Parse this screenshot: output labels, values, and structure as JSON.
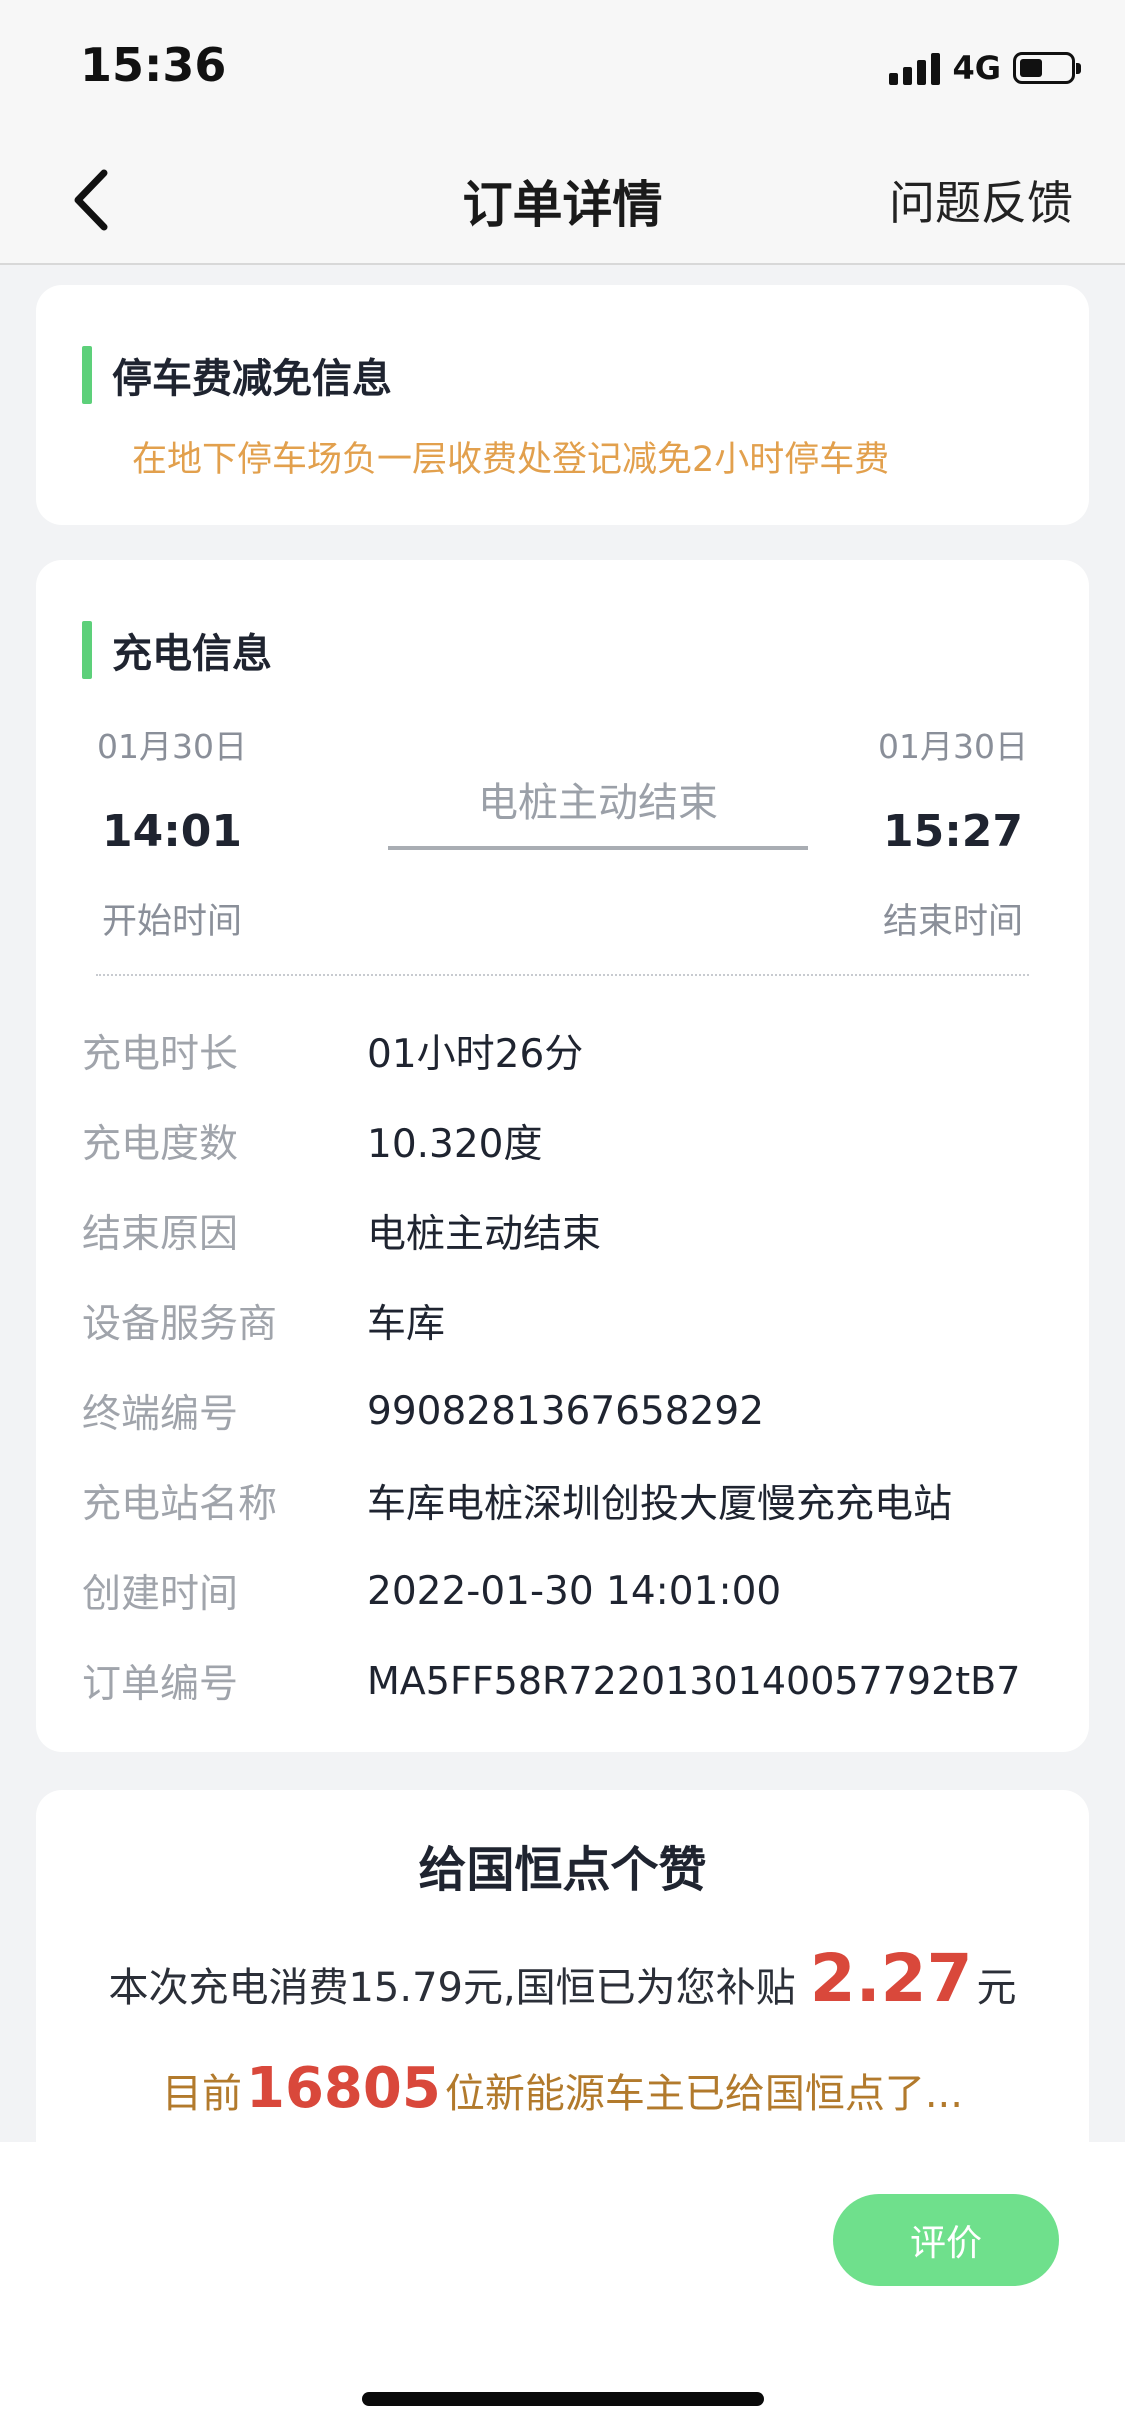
{
  "status_bar": {
    "time": "15:36",
    "network": "4G",
    "battery_level": 0.45
  },
  "nav": {
    "title": "订单详情",
    "feedback": "问题反馈",
    "back_icon": "chevron-left-icon"
  },
  "parking": {
    "title": "停车费减免信息",
    "note": "在地下停车场负一层收费处登记减免2小时停车费"
  },
  "charging": {
    "title": "充电信息",
    "start": {
      "date": "01月30日",
      "time": "14:01",
      "label": "开始时间"
    },
    "end": {
      "date": "01月30日",
      "time": "15:27",
      "label": "结束时间"
    },
    "end_reason": "电桩主动结束",
    "details": [
      {
        "label": "充电时长",
        "value": "01小时26分"
      },
      {
        "label": "充电度数",
        "value": "10.320度"
      },
      {
        "label": "结束原因",
        "value": "电桩主动结束"
      },
      {
        "label": "设备服务商",
        "value": "车库"
      },
      {
        "label": "终端编号",
        "value": "9908281367658292"
      },
      {
        "label": "充电站名称",
        "value": "车库电桩深圳创投大厦慢充充电站"
      },
      {
        "label": "创建时间",
        "value": "2022-01-30 14:01:00"
      },
      {
        "label": "订单编号",
        "value": "MA5FF58R7220130140057792tB7"
      }
    ]
  },
  "like": {
    "title": "给国恒点个赞",
    "line1_prefix": "本次充电消费15.79元,国恒已为您补贴",
    "subsidy": "2.27",
    "line1_suffix": "元",
    "line2_prefix": "目前",
    "count": "16805",
    "line2_suffix": "位新能源车主已给国恒点了..."
  },
  "bottom": {
    "rate_label": "评价"
  },
  "colors": {
    "accent_green": "#5dd07a",
    "button_green": "#6fe08c",
    "highlight_red": "#d9483b",
    "note_orange": "#e2a04d"
  }
}
